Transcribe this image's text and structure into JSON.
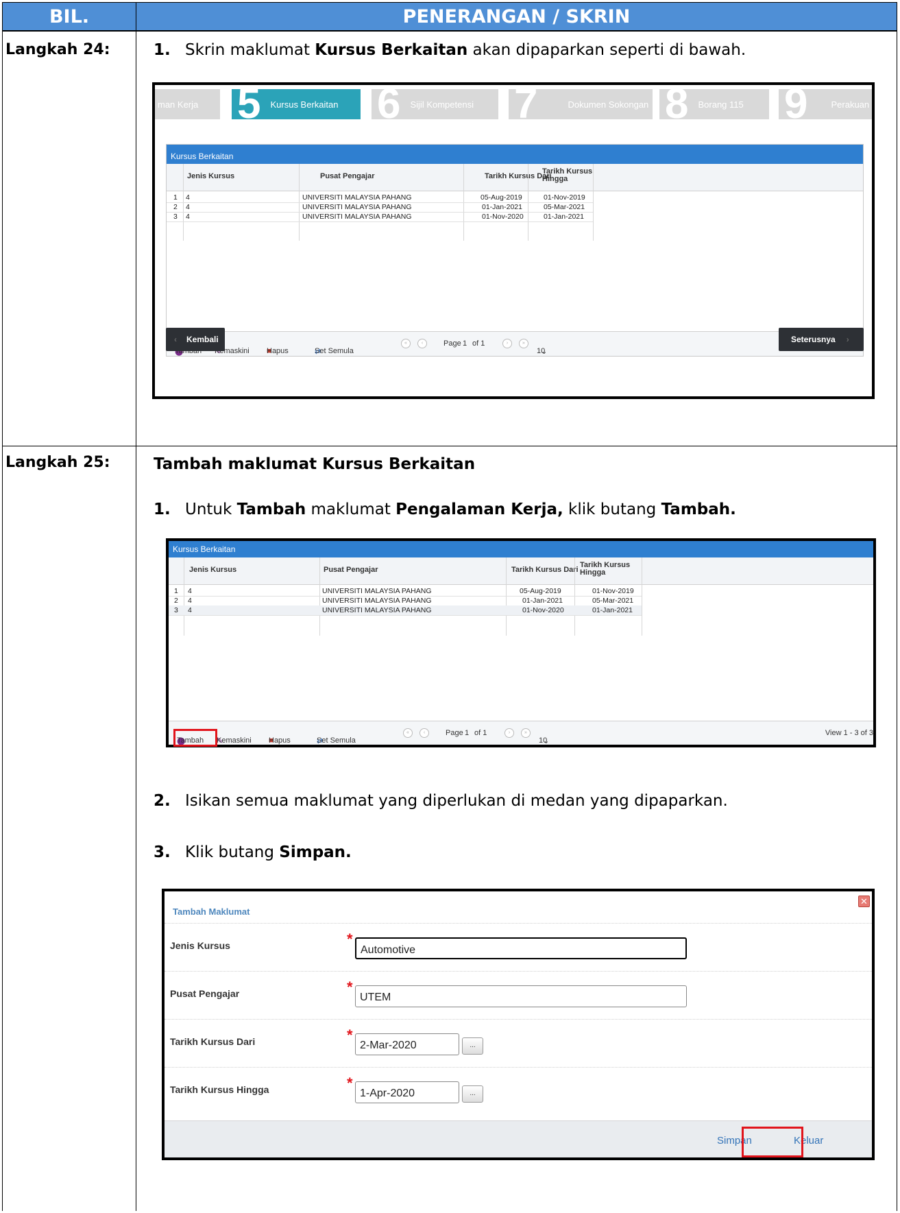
{
  "header": {
    "bil": "BIL.",
    "penerangan": "PENERANGAN / SKRIN"
  },
  "step24": {
    "label": "Langkah 24:",
    "item1_num": "1.",
    "item1_pre": "Skrin maklumat ",
    "item1_bold": "Kursus Berkaitan",
    "item1_post": " akan dipaparkan seperti di bawah."
  },
  "step25": {
    "label": "Langkah 25:",
    "heading": "Tambah maklumat Kursus Berkaitan",
    "item1_num": "1.",
    "item1_a": "Untuk ",
    "item1_b": "Tambah",
    "item1_c": " maklumat ",
    "item1_d": "Pengalaman Kerja,",
    "item1_e": " klik butang ",
    "item1_f": "Tambah.",
    "item2_num": "2.",
    "item2_text": "Isikan semua maklumat yang diperlukan di medan yang dipaparkan.",
    "item3_num": "3.",
    "item3_pre": "Klik butang ",
    "item3_bold": "Simpan."
  },
  "tabs": [
    {
      "text": "man Kerja"
    },
    {
      "num": "5",
      "text": "Kursus Berkaitan"
    },
    {
      "num": "6",
      "text": "Sijil Kompetensi"
    },
    {
      "num": "7",
      "text": "Dokumen Sokongan"
    },
    {
      "num": "8",
      "text": "Borang 115"
    },
    {
      "num": "9",
      "text": "Perakuan"
    }
  ],
  "grid": {
    "title": "Kursus Berkaitan",
    "columns": [
      "Jenis Kursus",
      "Pusat Pengajar",
      "Tarikh Kursus Dari",
      "Tarikh Kursus",
      "Hingga"
    ],
    "rows": [
      {
        "no": "1",
        "jenis": "4",
        "pusat": "UNIVERSITI MALAYSIA PAHANG",
        "dari": "05-Aug-2019",
        "hingga": "01-Nov-2019"
      },
      {
        "no": "2",
        "jenis": "4",
        "pusat": "UNIVERSITI MALAYSIA PAHANG",
        "dari": "01-Jan-2021",
        "hingga": "05-Mar-2021"
      },
      {
        "no": "3",
        "jenis": "4",
        "pusat": "UNIVERSITI MALAYSIA PAHANG",
        "dari": "01-Nov-2020",
        "hingga": "01-Jan-2021"
      }
    ],
    "pager": {
      "tambah": "Tambah",
      "kemaskini": "Kemaskini",
      "hapus": "Hapus",
      "set_semula": "Set Semula",
      "page_label": "Page",
      "page_value": "1",
      "of_label": "of 1",
      "page_size": "10",
      "view": "View 1 - 3 of 3"
    }
  },
  "nav": {
    "back": "Kembali",
    "next": "Seterusnya"
  },
  "form": {
    "title": "Tambah Maklumat",
    "fields": [
      {
        "label": "Jenis Kursus",
        "value": "Automotive"
      },
      {
        "label": "Pusat Pengajar",
        "value": "UTEM"
      },
      {
        "label": "Tarikh Kursus Dari",
        "value": "2-Mar-2020"
      },
      {
        "label": "Tarikh Kursus Hingga",
        "value": "1-Apr-2020"
      }
    ],
    "required_mark": "*",
    "dots": "...",
    "close": "✕",
    "save": "Simpan",
    "cancel": "Keluar"
  }
}
